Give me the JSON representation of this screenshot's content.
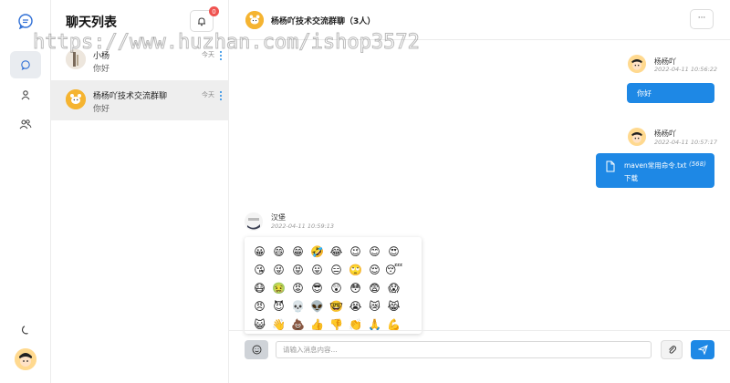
{
  "rail": {
    "icons": [
      "chat-logo-icon",
      "message-icon",
      "user-icon",
      "users-icon",
      "moon-icon",
      "avatar"
    ]
  },
  "list": {
    "title": "聊天列表",
    "notification_count": "0",
    "conversations": [
      {
        "name": "小杨",
        "message": "你好",
        "time": "今天"
      },
      {
        "name": "杨杨吖技术交流群聊",
        "message": "你好",
        "time": "今天"
      }
    ]
  },
  "chat": {
    "title": "杨杨吖技术交流群聊（3人）",
    "more_label": "···",
    "messages": [
      {
        "sender": "杨杨吖",
        "time": "2022-04-11 10:56:22",
        "text": "你好"
      },
      {
        "sender": "杨杨吖",
        "time": "2022-04-11 10:57:17",
        "file_name": "maven常用命令.txt",
        "file_size": "(568)",
        "download_label": "下载"
      },
      {
        "sender": "汉堡",
        "time": "2022-04-11 10:59:13"
      }
    ]
  },
  "emoji_panel": {
    "emojis": [
      "😀",
      "😄",
      "😁",
      "🤣",
      "😂",
      "😉",
      "😊",
      "😍",
      "😘",
      "😜",
      "😝",
      "😛",
      "😑",
      "🙄",
      "😌",
      "😴",
      "😷",
      "🤢",
      "😡",
      "😎",
      "😲",
      "😳",
      "😨",
      "😱",
      "😠",
      "😈",
      "💀",
      "👽",
      "🤓",
      "😭",
      "😿",
      "😹",
      "😺",
      "👋",
      "💩",
      "👍",
      "👎",
      "👏",
      "🙏",
      "💪"
    ]
  },
  "composer": {
    "placeholder": "请输入消息内容..."
  },
  "watermark": "https://www.huzhan.com/ishop3572",
  "colors": {
    "accent": "#1e88e5",
    "badge": "#ef5350"
  }
}
